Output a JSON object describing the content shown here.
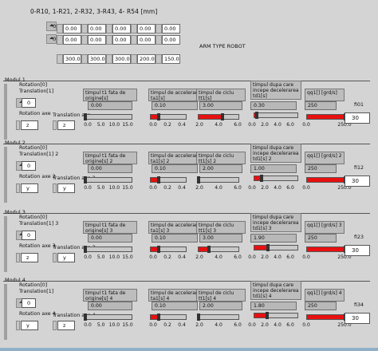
{
  "header": "0-R10, 1-R21, 2-R32, 3-R43, 4- R54 [mm]",
  "title": "ARM TYPE ROBOT",
  "matrix": {
    "index_rows": [
      "0",
      "0"
    ],
    "rows": [
      [
        "0.00",
        "0.00",
        "0.00",
        "0.00",
        "0.00"
      ],
      [
        "0.00",
        "0.00",
        "0.00",
        "0.00",
        "0.00"
      ],
      [
        "300.00",
        "300.00",
        "300.00",
        "200.00",
        "150.00"
      ]
    ]
  },
  "scales": {
    "time": [
      "0.0",
      "5.0",
      "10.0",
      "15.0"
    ],
    "accel": [
      "0.0",
      "0.2",
      "0.4"
    ],
    "cycle": [
      "2.0",
      "4.0",
      "6.0"
    ],
    "decel": [
      "0.0",
      "2.0",
      "4.0",
      "6.0"
    ],
    "qq": [
      "0.0",
      "250.0"
    ]
  },
  "modules": [
    {
      "name": "Modul 1",
      "rotation": "Rotation[0]",
      "translation": "Translation[1]",
      "rot_axis_label": "Rotation axe",
      "trans_axis_label": "Translation axe",
      "idx_rot": "0",
      "idx_axis": "z",
      "idx_trans_axis": "z",
      "t1_label": "timpul t1 fata de origine[s]",
      "t1_val": "0.00",
      "acc_label": "timpul de accelerare ta1[s]",
      "acc_val": "0.10",
      "cyc_label": "timpul de ciclu tt1[s]",
      "cyc_val": "3.00",
      "dec_label": "timpul dupa care incepe decelerarea td1[s]",
      "dec_val": "0.30",
      "qq_label": "qq1[] [grd/s]",
      "qq_val": "250",
      "fi_label": "fi01",
      "fi_val": "30",
      "t1_fill": 0.0,
      "acc_fill": 0.22,
      "cyc_fill": 0.6,
      "dec_fill": 0.06,
      "qq_fill": 1.0
    },
    {
      "name": "Modul 2",
      "rotation": "Rotation[0]",
      "translation": "Translation[1] 2",
      "rot_axis_label": "Rotation axe 2",
      "trans_axis_label": "Translation axe 2",
      "idx_rot": "0",
      "idx_axis": "y",
      "idx_trans_axis": "y",
      "t1_label": "timpul t1 fata de origine[s] 2",
      "t1_val": "0.00",
      "acc_label": "timpul de accelerare ta1[s] 2",
      "acc_val": "0.10",
      "cyc_label": "timpul de ciclu tt1[s] 2",
      "cyc_val": "2.00",
      "dec_label": "timpul dupa care incepe decelerarea td1[s] 2",
      "dec_val": "1.00",
      "qq_label": "qq1[] [grd/s] 2",
      "qq_val": "250",
      "fi_label": "fi12",
      "fi_val": "30",
      "t1_fill": 0.0,
      "acc_fill": 0.22,
      "cyc_fill": 0.0,
      "dec_fill": 0.17,
      "qq_fill": 1.0
    },
    {
      "name": "Modul 3",
      "rotation": "Rotation[0]",
      "translation": "Translation[1] 3",
      "rot_axis_label": "Rotation axe 3",
      "trans_axis_label": "Translation axe 3",
      "idx_rot": "0",
      "idx_axis": "z",
      "idx_trans_axis": "y",
      "t1_label": "timpul t1 fata de origine[s] 3",
      "t1_val": "0.00",
      "acc_label": "timpul de accelerare ta1[s] 3",
      "acc_val": "0.10",
      "cyc_label": "timpul de ciclu tt1[s] 3",
      "cyc_val": "3.00",
      "dec_label": "timpul dupa care incepe decelerarea td1[s] 3",
      "dec_val": "1.90",
      "qq_label": "qq1[] [grd/s] 3",
      "qq_val": "250",
      "fi_label": "fi23",
      "fi_val": "30",
      "t1_fill": 0.0,
      "acc_fill": 0.22,
      "cyc_fill": 0.25,
      "dec_fill": 0.32,
      "qq_fill": 1.0
    },
    {
      "name": "Modul 4",
      "rotation": "Rotation[0]",
      "translation": "Translation[1]",
      "rot_axis_label": "Rotation axe 4",
      "trans_axis_label": "Translation axe 4",
      "idx_rot": "0",
      "idx_axis": "y",
      "idx_trans_axis": "z",
      "t1_label": "timpul t1 fata de origine[s] 4",
      "t1_val": "0.00",
      "acc_label": "timpul de accelerare ta1[s] 4",
      "acc_val": "0.10",
      "cyc_label": "timpul de ciclu tt1[s] 4",
      "cyc_val": "2.00",
      "dec_label": "timpul dupa care incepe decelerarea td1[s] 4",
      "dec_val": "1.80",
      "qq_label": "qq1[] [grd/s] 4",
      "qq_val": "250",
      "fi_label": "fi34",
      "fi_val": "30",
      "t1_fill": 0.0,
      "acc_fill": 0.22,
      "cyc_fill": 0.0,
      "dec_fill": 0.3,
      "qq_fill": 1.0
    }
  ]
}
